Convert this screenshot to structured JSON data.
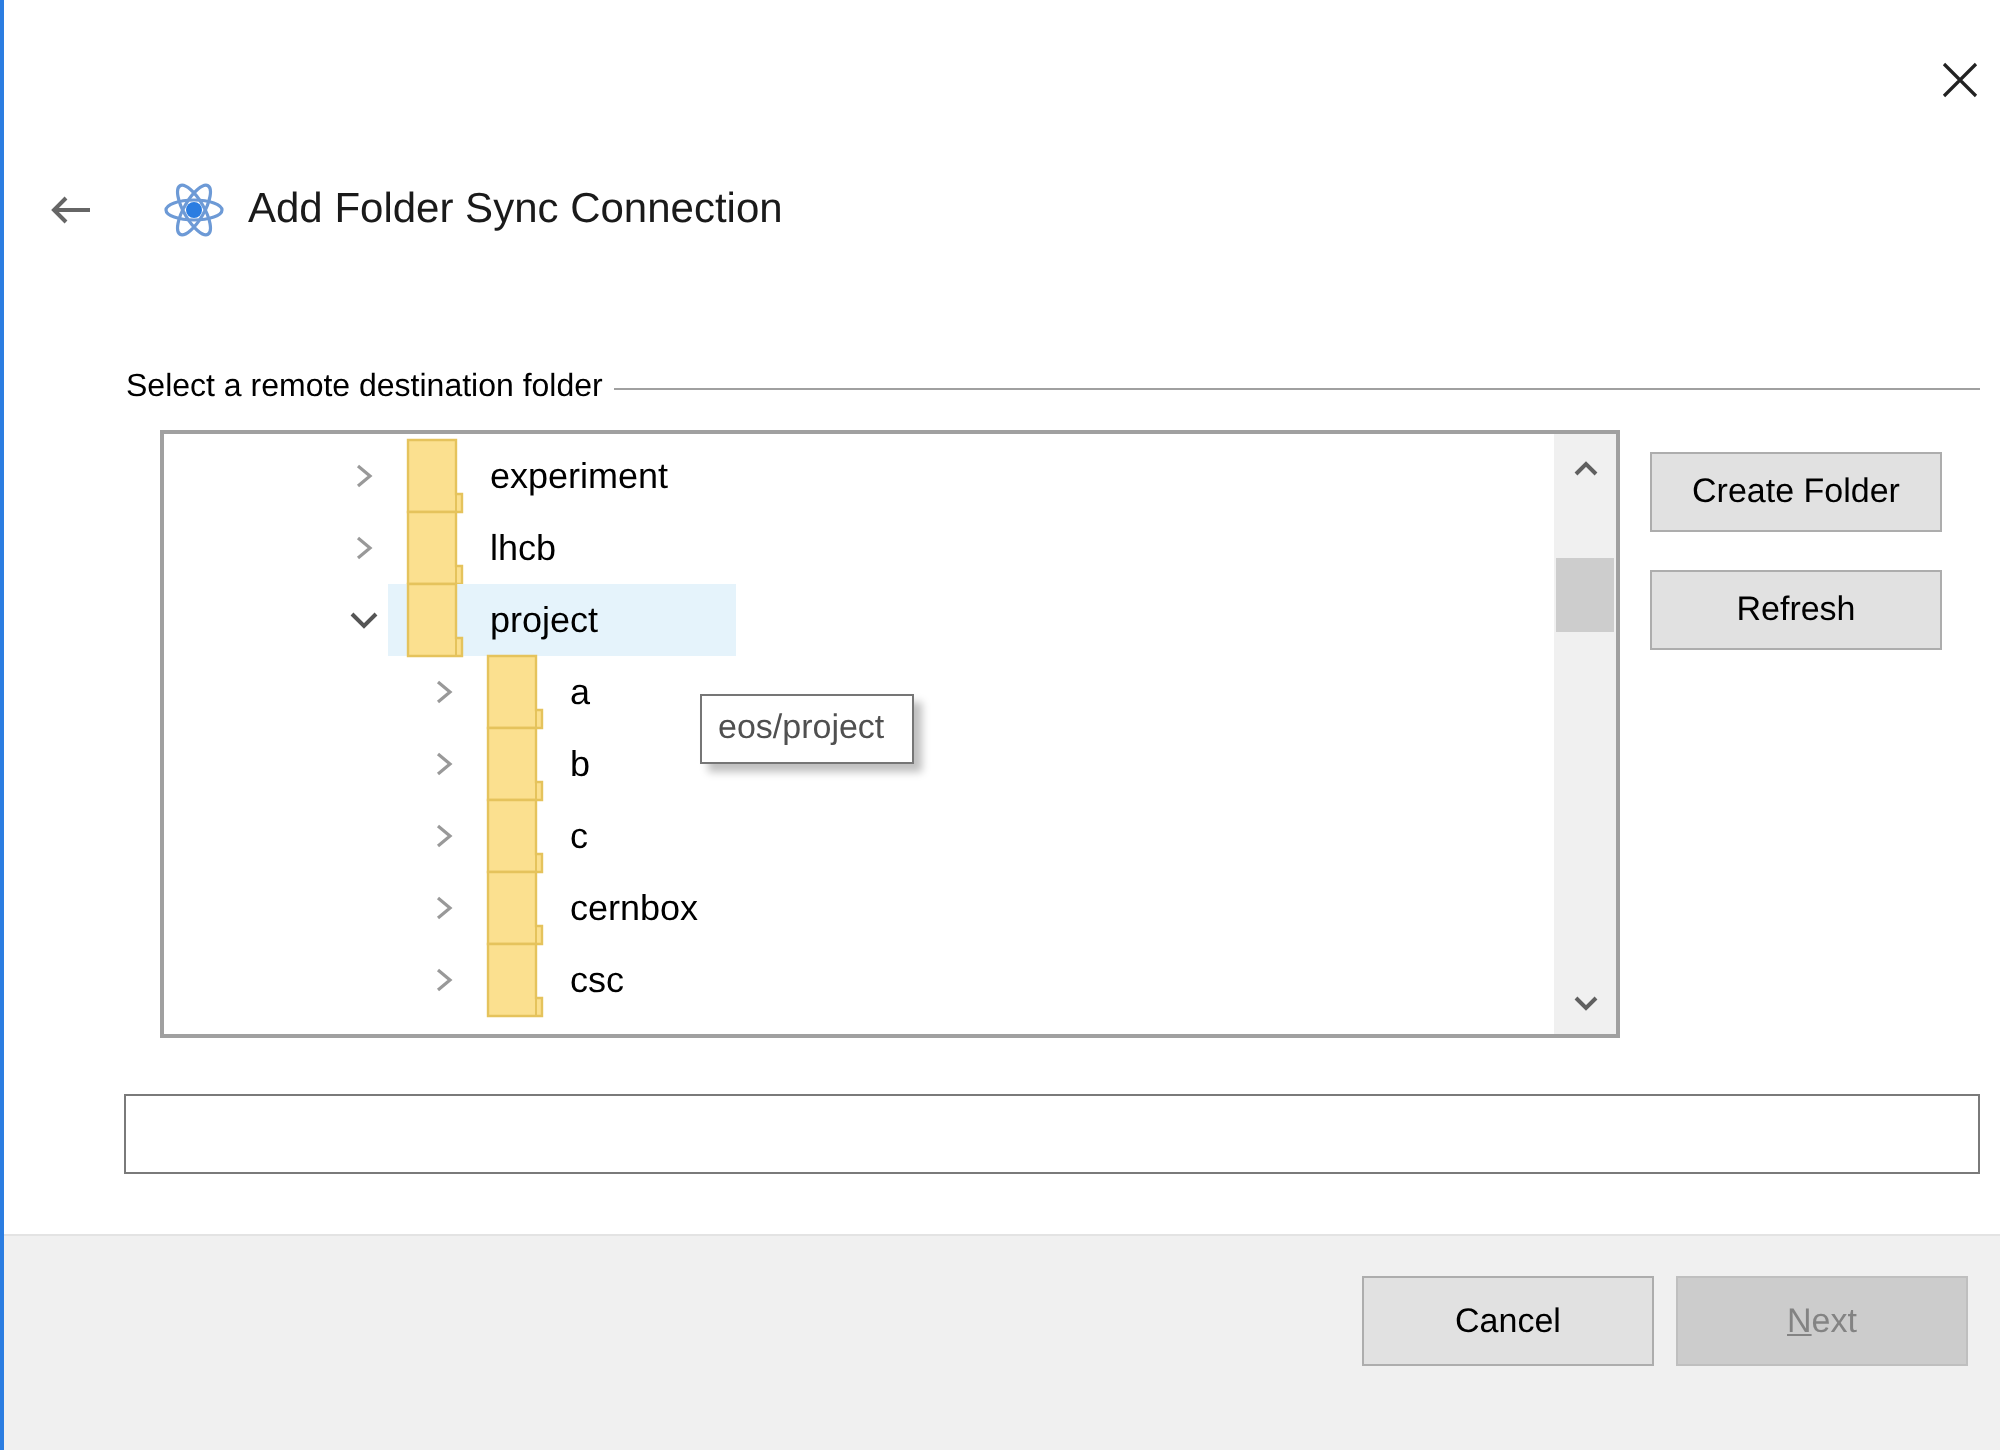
{
  "header": {
    "title": "Add Folder Sync Connection"
  },
  "group": {
    "label": "Select a remote destination folder"
  },
  "tree": {
    "items": [
      {
        "label": "experiment",
        "expanded": false,
        "selected": false
      },
      {
        "label": "lhcb",
        "expanded": false,
        "selected": false
      },
      {
        "label": "project",
        "expanded": true,
        "selected": true,
        "children": [
          {
            "label": "a",
            "expanded": false,
            "selected": false
          },
          {
            "label": "b",
            "expanded": false,
            "selected": false
          },
          {
            "label": "c",
            "expanded": false,
            "selected": false
          },
          {
            "label": "cernbox",
            "expanded": false,
            "selected": false
          },
          {
            "label": "csc",
            "expanded": false,
            "selected": false
          }
        ]
      }
    ]
  },
  "tooltip": {
    "text": "eos/project"
  },
  "side_buttons": [
    "Create Folder",
    "Refresh"
  ],
  "footer_buttons": [
    {
      "label": "Cancel",
      "disabled": false
    },
    {
      "label": "Next",
      "disabled": true
    }
  ]
}
